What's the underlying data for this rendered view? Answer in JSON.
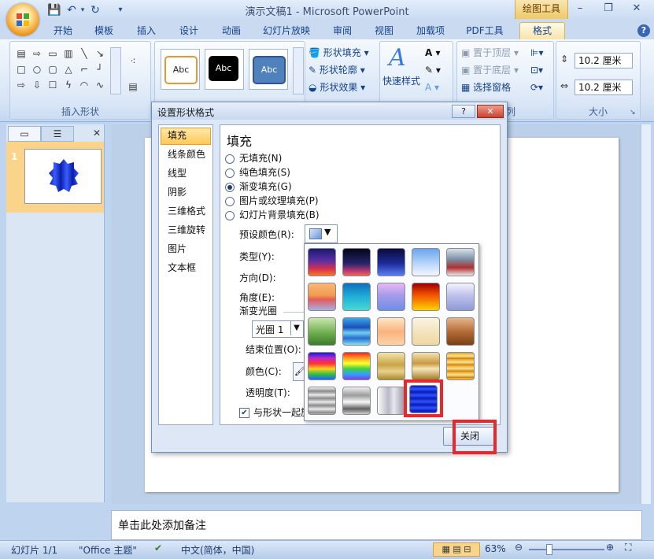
{
  "window": {
    "title": "演示文稿1 - Microsoft PowerPoint",
    "contextual_tools": "绘图工具",
    "help_glyph": "?"
  },
  "tabs": [
    "开始",
    "模板",
    "插入",
    "设计",
    "动画",
    "幻灯片放映",
    "审阅",
    "视图",
    "加载项",
    "PDF工具",
    "格式"
  ],
  "ribbon": {
    "insert_shapes_label": "插入形状",
    "shape_style_samples": [
      "Abc",
      "Abc",
      "Abc"
    ],
    "shape_fill": "形状填充",
    "shape_outline": "形状轮廓",
    "shape_effects": "形状效果",
    "quick_styles": "快速样式",
    "bring_front": "置于顶层",
    "send_back": "置于底层",
    "selection_pane": "选择窗格",
    "arrange_partial": "列",
    "size_label": "大小",
    "height_value": "10.2 厘米",
    "width_value": "10.2 厘米"
  },
  "slide_pane": {
    "slide_number": "1"
  },
  "notes_placeholder": "单击此处添加备注",
  "status": {
    "slide": "幻灯片 1/1",
    "theme": "\"Office 主题\"",
    "language": "中文(简体，中国)",
    "zoom": "63%"
  },
  "dialog": {
    "title": "设置形状格式",
    "help": "?",
    "nav": [
      "填充",
      "线条颜色",
      "线型",
      "阴影",
      "三维格式",
      "三维旋转",
      "图片",
      "文本框"
    ],
    "selected_nav": "填充",
    "panel_heading": "填充",
    "fill_options": [
      "无填充(N)",
      "纯色填充(S)",
      "渐变填充(G)",
      "图片或纹理填充(P)",
      "幻灯片背景填充(B)"
    ],
    "selected_fill": "渐变填充(G)",
    "preset_colors": "预设颜色(R):",
    "type": "类型(Y):",
    "direction": "方向(D):",
    "angle": "角度(E):",
    "gradient_stops": "渐变光圈",
    "stop_select": "光圈 1",
    "end_position": "结束位置(O):",
    "color": "颜色(C):",
    "transparency": "透明度(T):",
    "rotate_with_shape": "与形状一起旋",
    "close": "关闭"
  },
  "colors": {
    "accent_highlight": "#e8282b",
    "shape_blue": "#1030c8"
  }
}
